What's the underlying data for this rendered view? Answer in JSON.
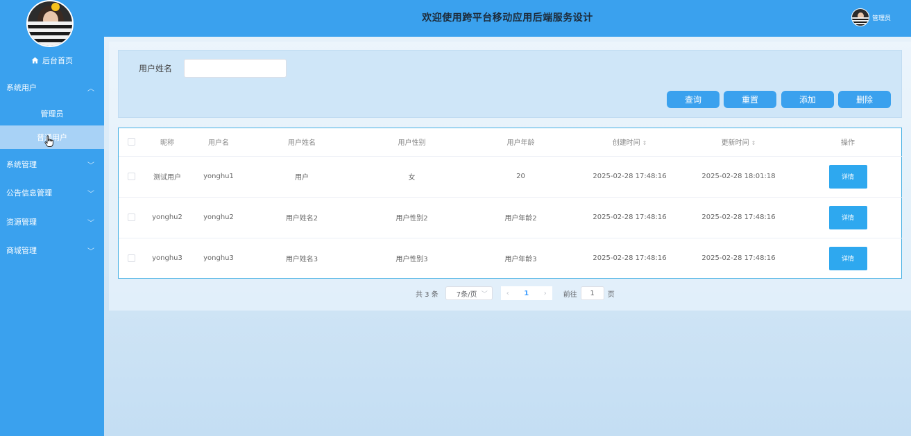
{
  "header": {
    "title": "欢迎使用跨平台移动应用后端服务设计",
    "user_label": "管理员"
  },
  "sidebar": {
    "home_label": "后台首页",
    "groups": [
      {
        "label": "系统用户",
        "expanded": true,
        "children": [
          "管理员",
          "普通用户"
        ]
      },
      {
        "label": "系统管理",
        "expanded": false
      },
      {
        "label": "公告信息管理",
        "expanded": false
      },
      {
        "label": "资源管理",
        "expanded": false
      },
      {
        "label": "商城管理",
        "expanded": false
      }
    ],
    "active_item": "普通用户"
  },
  "search": {
    "field_label": "用户姓名",
    "field_value": "",
    "buttons": {
      "query": "查询",
      "reset": "重置",
      "add": "添加",
      "delete": "删除"
    }
  },
  "table": {
    "columns": [
      "昵称",
      "用户名",
      "用户姓名",
      "用户性别",
      "用户年龄",
      "创建时间",
      "更新时间",
      "操作"
    ],
    "rows": [
      {
        "nickname": "测试用户",
        "username": "yonghu1",
        "realname": "用户",
        "gender": "女",
        "age": "20",
        "created": "2025-02-28 17:48:16",
        "updated": "2025-02-28 18:01:18",
        "action": "详情"
      },
      {
        "nickname": "yonghu2",
        "username": "yonghu2",
        "realname": "用户姓名2",
        "gender": "用户性别2",
        "age": "用户年龄2",
        "created": "2025-02-28 17:48:16",
        "updated": "2025-02-28 17:48:16",
        "action": "详情"
      },
      {
        "nickname": "yonghu3",
        "username": "yonghu3",
        "realname": "用户姓名3",
        "gender": "用户性别3",
        "age": "用户年龄3",
        "created": "2025-02-28 17:48:16",
        "updated": "2025-02-28 17:48:16",
        "action": "详情"
      }
    ]
  },
  "pagination": {
    "total": "共 3 条",
    "page_size": "7条/页",
    "current_page": "1",
    "goto_prefix": "前往",
    "goto_value": "1",
    "goto_suffix": "页"
  },
  "colors": {
    "primary": "#3aa1ee",
    "active_item_bg": "#a8d2f6",
    "table_border": "#45b0e4"
  }
}
